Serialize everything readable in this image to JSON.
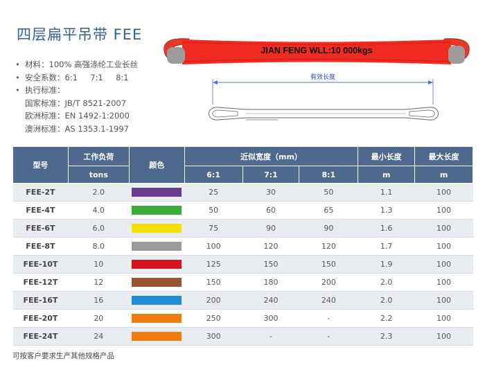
{
  "title": "四层扁平吊带 FEE",
  "specs": {
    "material": "材料：100% 高强涤纶工业长丝",
    "safety_label": "安全系数：",
    "safety_values": "6:1     7:1     8:1",
    "standards_label": "执行标准：",
    "standards": [
      {
        "label": "国家标准：",
        "value": "JB/T 8521-2007"
      },
      {
        "label": "欧洲标准：",
        "value": "EN 1492-1:2000"
      },
      {
        "label": "澳洲标准：",
        "value": "AS 1353.1-1997"
      }
    ]
  },
  "figure": {
    "sling_text": "JIAN FENG WLL:10 000kgs",
    "effective_length_label": "有效长度"
  },
  "table": {
    "headers": {
      "model": "型号",
      "wll": "工作负荷",
      "wll_unit": "tons",
      "color": "颜色",
      "width": "近似宽度（mm）",
      "ratio_6": "6:1",
      "ratio_7": "7:1",
      "ratio_8": "8:1",
      "min_length": "最小长度",
      "min_unit": "m",
      "max_length": "最大长度",
      "max_unit": "m"
    },
    "rows": [
      {
        "model": "FEE-2T",
        "wll": "2.0",
        "color": "#6a3a8c",
        "w6": "25",
        "w7": "30",
        "w8": "50",
        "min": "1.1",
        "max": "100"
      },
      {
        "model": "FEE-4T",
        "wll": "4.0",
        "color": "#3aab3a",
        "w6": "50",
        "w7": "60",
        "w8": "65",
        "min": "1.3",
        "max": "100"
      },
      {
        "model": "FEE-6T",
        "wll": "6.0",
        "color": "#f5e100",
        "w6": "75",
        "w7": "90",
        "w8": "90",
        "min": "1.6",
        "max": "100"
      },
      {
        "model": "FEE-8T",
        "wll": "8.0",
        "color": "#9a9a9a",
        "w6": "100",
        "w7": "120",
        "w8": "120",
        "min": "1.7",
        "max": "100"
      },
      {
        "model": "FEE-10T",
        "wll": "10",
        "color": "#d4151d",
        "w6": "125",
        "w7": "150",
        "w8": "150",
        "min": "1.9",
        "max": "100"
      },
      {
        "model": "FEE-12T",
        "wll": "12",
        "color": "#9a5530",
        "w6": "150",
        "w7": "180",
        "w8": "200",
        "min": "2.0",
        "max": "100"
      },
      {
        "model": "FEE-16T",
        "wll": "16",
        "color": "#1e8fd5",
        "w6": "200",
        "w7": "240",
        "w8": "240",
        "min": "2.0",
        "max": "100"
      },
      {
        "model": "FEE-20T",
        "wll": "20",
        "color": "#ef7d10",
        "w6": "250",
        "w7": "300",
        "w8": "-",
        "min": "2.2",
        "max": "100"
      },
      {
        "model": "FEE-24T",
        "wll": "24",
        "color": "#ef7d10",
        "w6": "300",
        "w7": "-",
        "w8": "-",
        "min": "2.3",
        "max": "100"
      }
    ]
  },
  "note": "可按客户要求生产其他规格产品"
}
